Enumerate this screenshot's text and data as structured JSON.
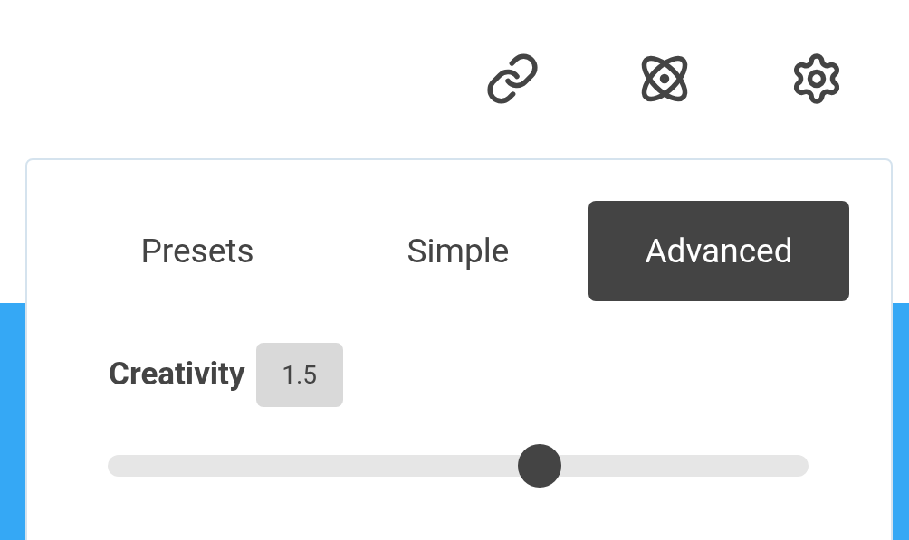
{
  "tabs": [
    {
      "label": "Presets",
      "selected": false
    },
    {
      "label": "Simple",
      "selected": false
    },
    {
      "label": "Advanced",
      "selected": true
    }
  ],
  "creativity": {
    "label": "Creativity",
    "value": "1.5",
    "level": 0.616
  }
}
